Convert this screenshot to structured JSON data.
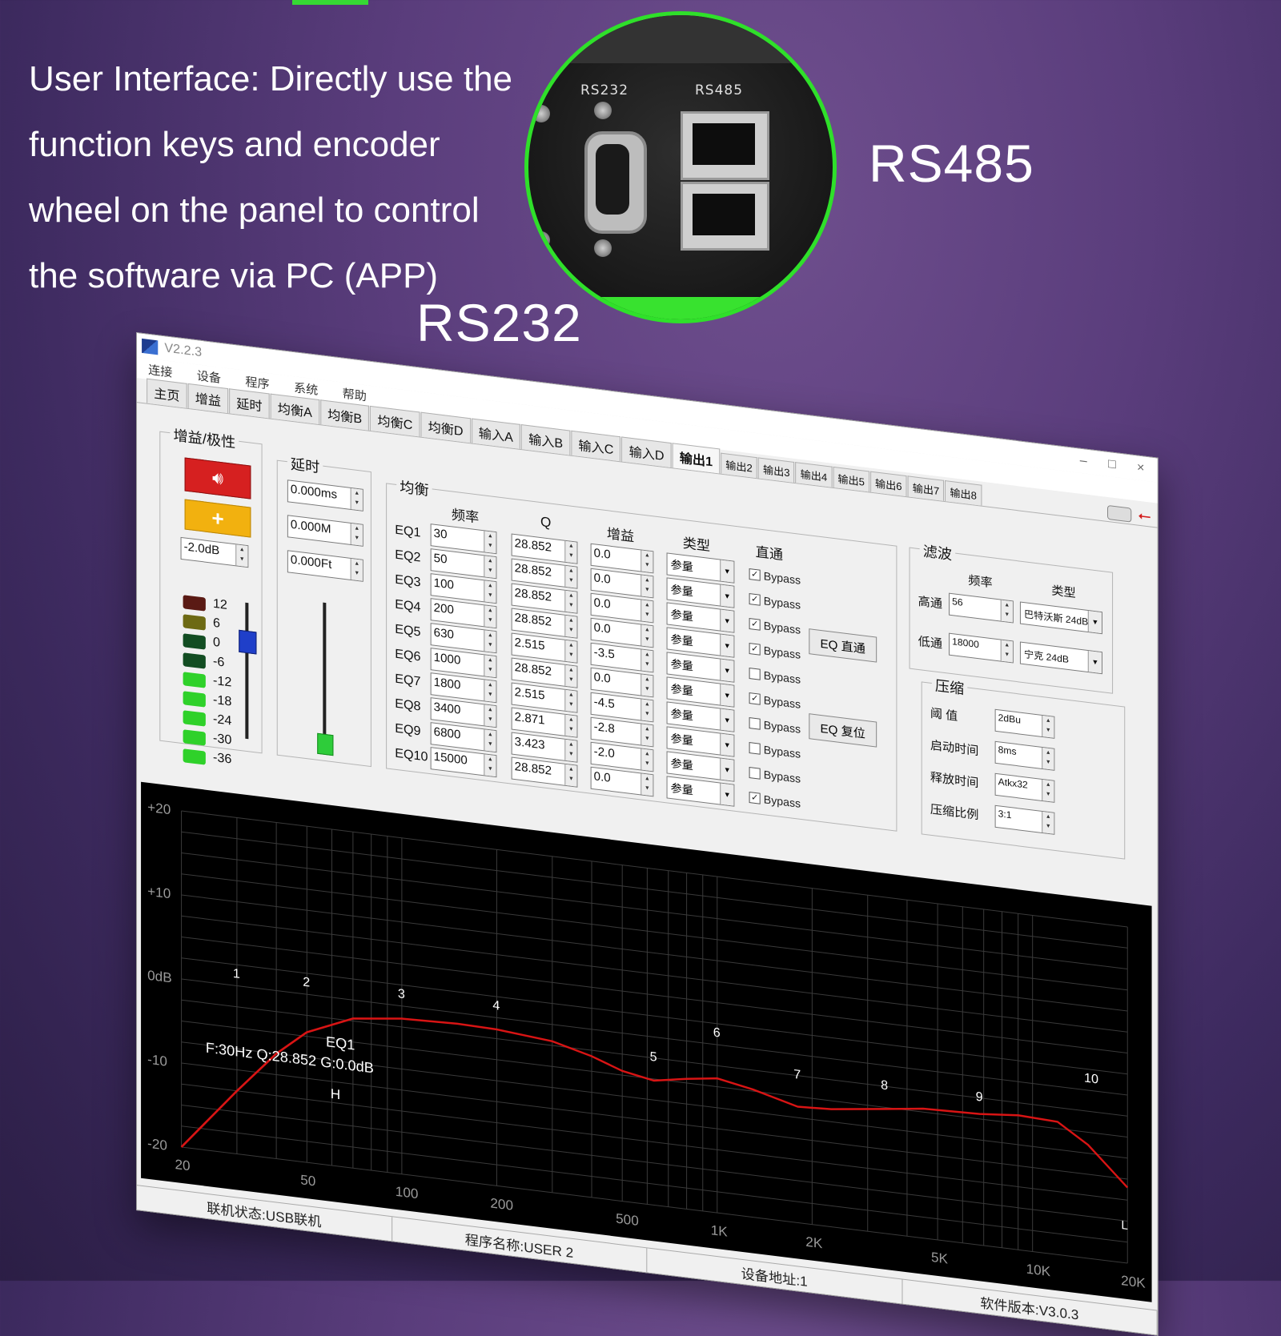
{
  "promo": {
    "lines": [
      "User Interface: Directly use the",
      "function keys and encoder",
      "wheel on the panel to control",
      "the software via PC (APP)"
    ],
    "rs485_label": "RS485",
    "rs232_label": "RS232",
    "port_labels": {
      "rs232": "RS232",
      "rs485": "RS485"
    }
  },
  "window": {
    "version": "V2.2.3",
    "controls": [
      "–",
      "□",
      "×"
    ],
    "menu": [
      "连接",
      "设备",
      "程序",
      "系统",
      "帮助"
    ],
    "tabs": [
      "主页",
      "增益",
      "延时",
      "均衡A",
      "均衡B",
      "均衡C",
      "均衡D",
      "输入A",
      "输入B",
      "输入C",
      "输入D",
      "输出1",
      "输出2",
      "输出3",
      "输出4",
      "输出5",
      "输出6",
      "输出7",
      "输出8"
    ],
    "active_tab": "输出1"
  },
  "gain": {
    "title": "增益/极性",
    "mute_icon": "speaker-icon",
    "polarity_symbol": "+",
    "value": "-2.0dB",
    "meter_labels": [
      "12",
      "6",
      "0",
      "-6",
      "-12",
      "-18",
      "-24",
      "-30",
      "-36"
    ],
    "meter_colors": [
      "#5a1a14",
      "#6d6a14",
      "#124d22",
      "#124d22",
      "#2fd12a",
      "#2fd12a",
      "#2fd12a",
      "#2fd12a",
      "#2fd12a"
    ],
    "fader_level": 0.72
  },
  "delay": {
    "title": "延时",
    "ms": "0.000ms",
    "m": "0.000M",
    "ft": "0.000Ft",
    "fader_level": 0.05
  },
  "eq": {
    "title": "均衡",
    "headers": {
      "freq": "频率",
      "q": "Q",
      "gain": "增益",
      "type": "类型",
      "bypass": "直通"
    },
    "bands": [
      {
        "label": "EQ1",
        "freq": "30",
        "q": "28.852",
        "gain": "0.0",
        "type": "参量",
        "bypass": true
      },
      {
        "label": "EQ2",
        "freq": "50",
        "q": "28.852",
        "gain": "0.0",
        "type": "参量",
        "bypass": true
      },
      {
        "label": "EQ3",
        "freq": "100",
        "q": "28.852",
        "gain": "0.0",
        "type": "参量",
        "bypass": true
      },
      {
        "label": "EQ4",
        "freq": "200",
        "q": "28.852",
        "gain": "0.0",
        "type": "参量",
        "bypass": true
      },
      {
        "label": "EQ5",
        "freq": "630",
        "q": "2.515",
        "gain": "-3.5",
        "type": "参量",
        "bypass": false
      },
      {
        "label": "EQ6",
        "freq": "1000",
        "q": "28.852",
        "gain": "0.0",
        "type": "参量",
        "bypass": true
      },
      {
        "label": "EQ7",
        "freq": "1800",
        "q": "2.515",
        "gain": "-4.5",
        "type": "参量",
        "bypass": false
      },
      {
        "label": "EQ8",
        "freq": "3400",
        "q": "2.871",
        "gain": "-2.8",
        "type": "参量",
        "bypass": false
      },
      {
        "label": "EQ9",
        "freq": "6800",
        "q": "3.423",
        "gain": "-2.0",
        "type": "参量",
        "bypass": false
      },
      {
        "label": "EQ10",
        "freq": "15000",
        "q": "28.852",
        "gain": "0.0",
        "type": "参量",
        "bypass": true
      }
    ],
    "bypass_text": "Bypass",
    "eq_bypass_button": "EQ 直通",
    "eq_reset_button": "EQ 复位"
  },
  "crossover": {
    "title": "滤波",
    "freq_head": "频率",
    "type_head": "类型",
    "high_label": "高通",
    "high_freq": "56",
    "high_type": "巴特沃斯 24dB",
    "low_label": "低通",
    "low_freq": "18000",
    "low_type": "宁克 24dB"
  },
  "compressor": {
    "title": "压缩",
    "threshold_label": "阈  值",
    "threshold": "2dBu",
    "attack_label": "启动时间",
    "attack": "8ms",
    "release_label": "释放时间",
    "release": "Atkx32",
    "ratio_label": "压缩比例",
    "ratio": "3:1"
  },
  "chart_data": {
    "type": "line",
    "y_ticks": [
      "+20",
      "+10",
      "0dB",
      "-10",
      "-20"
    ],
    "ylim": [
      -20,
      20
    ],
    "x_ticks": [
      "20",
      "50",
      "100",
      "200",
      "500",
      "1K",
      "2K",
      "5K",
      "10K",
      "20K"
    ],
    "x_tick_values": [
      20,
      50,
      100,
      200,
      500,
      1000,
      2000,
      5000,
      10000,
      20000
    ],
    "xlim": [
      20,
      20000
    ],
    "x_scale": "log",
    "grid": true,
    "series": [
      {
        "color": "#d81414",
        "x": [
          20,
          30,
          40,
          50,
          70,
          100,
          150,
          200,
          300,
          400,
          500,
          630,
          800,
          1000,
          1300,
          1800,
          2300,
          3400,
          4500,
          6800,
          9000,
          12000,
          15000,
          20000
        ],
        "y": [
          -20,
          -12.5,
          -7.5,
          -4.5,
          -2.2,
          -1.5,
          -1.3,
          -1.4,
          -2.0,
          -3.2,
          -4.5,
          -5.2,
          -4.5,
          -4.0,
          -4.8,
          -6.2,
          -6.0,
          -5.2,
          -4.6,
          -4.4,
          -4.0,
          -4.2,
          -6.5,
          -11
        ]
      }
    ],
    "band_markers": [
      {
        "label": "1",
        "x": 30,
        "y": 0
      },
      {
        "label": "2",
        "x": 50,
        "y": 0
      },
      {
        "label": "3",
        "x": 100,
        "y": 0
      },
      {
        "label": "4",
        "x": 200,
        "y": 0
      },
      {
        "label": "5",
        "x": 630,
        "y": -3.5
      },
      {
        "label": "6",
        "x": 1000,
        "y": 0
      },
      {
        "label": "7",
        "x": 1800,
        "y": -4.5
      },
      {
        "label": "8",
        "x": 3400,
        "y": -2.8
      },
      {
        "label": "9",
        "x": 6800,
        "y": -2.0
      },
      {
        "label": "10",
        "x": 15000,
        "y": 0
      }
    ],
    "info_title": "EQ1",
    "info_text": "F:30Hz  Q:28.852  G:0.0dB",
    "hp_marker": "H",
    "lp_marker": "L"
  },
  "status": {
    "connection": "联机状态:USB联机",
    "program": "程序名称:USER 2",
    "address": "设备地址:1",
    "software": "软件版本:V3.0.3"
  }
}
